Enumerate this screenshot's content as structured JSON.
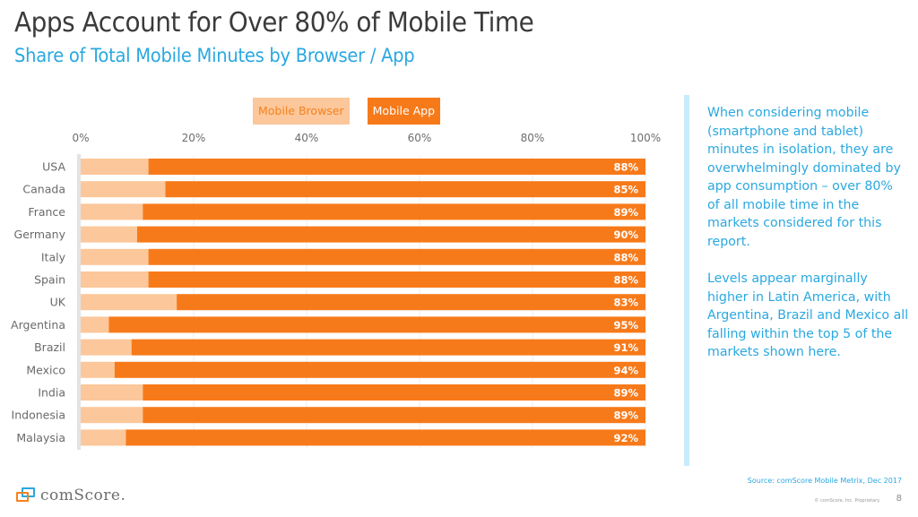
{
  "header": {
    "title": "Apps Account for Over 80% of Mobile Time",
    "subtitle": "Share of Total Mobile Minutes by Browser / App"
  },
  "chart_data": {
    "type": "bar",
    "orientation": "horizontal",
    "stacked": true,
    "title": "Share of Total Mobile Minutes by Browser / App",
    "categories": [
      "USA",
      "Canada",
      "France",
      "Germany",
      "Italy",
      "Spain",
      "UK",
      "Argentina",
      "Brazil",
      "Mexico",
      "India",
      "Indonesia",
      "Malaysia"
    ],
    "series": [
      {
        "name": "Mobile Browser",
        "color": "#fcc79a",
        "values": [
          12,
          15,
          11,
          10,
          12,
          12,
          17,
          5,
          9,
          6,
          11,
          11,
          8
        ]
      },
      {
        "name": "Mobile App",
        "color": "#f77a1a",
        "values": [
          88,
          85,
          89,
          90,
          88,
          88,
          83,
          95,
          91,
          94,
          89,
          89,
          92
        ]
      }
    ],
    "data_labels": [
      "88%",
      "85%",
      "89%",
      "90%",
      "88%",
      "88%",
      "83%",
      "95%",
      "91%",
      "94%",
      "89%",
      "89%",
      "92%"
    ],
    "x_ticks": [
      "0%",
      "20%",
      "40%",
      "60%",
      "80%",
      "100%"
    ],
    "xlim": [
      0,
      100
    ],
    "xlabel": "",
    "ylabel": "",
    "grid": true,
    "legend_position": "top-center"
  },
  "legend": {
    "browser_label": "Mobile Browser",
    "app_label": "Mobile App"
  },
  "sidebar": {
    "paragraph1": "When considering mobile (smartphone and tablet) minutes in isolation, they are overwhelmingly dominated by app consumption – over 80% of all mobile time in the markets considered for this report.",
    "paragraph2": "Levels appear marginally higher in Latin America, with Argentina, Brazil and Mexico all falling within the top 5 of the markets shown here."
  },
  "footer": {
    "source": "Source: comScore Mobile Metrix, Dec 2017",
    "copyright": "© comScore, Inc. Proprietary.",
    "page_number": "8",
    "logo_text": "comScore."
  }
}
